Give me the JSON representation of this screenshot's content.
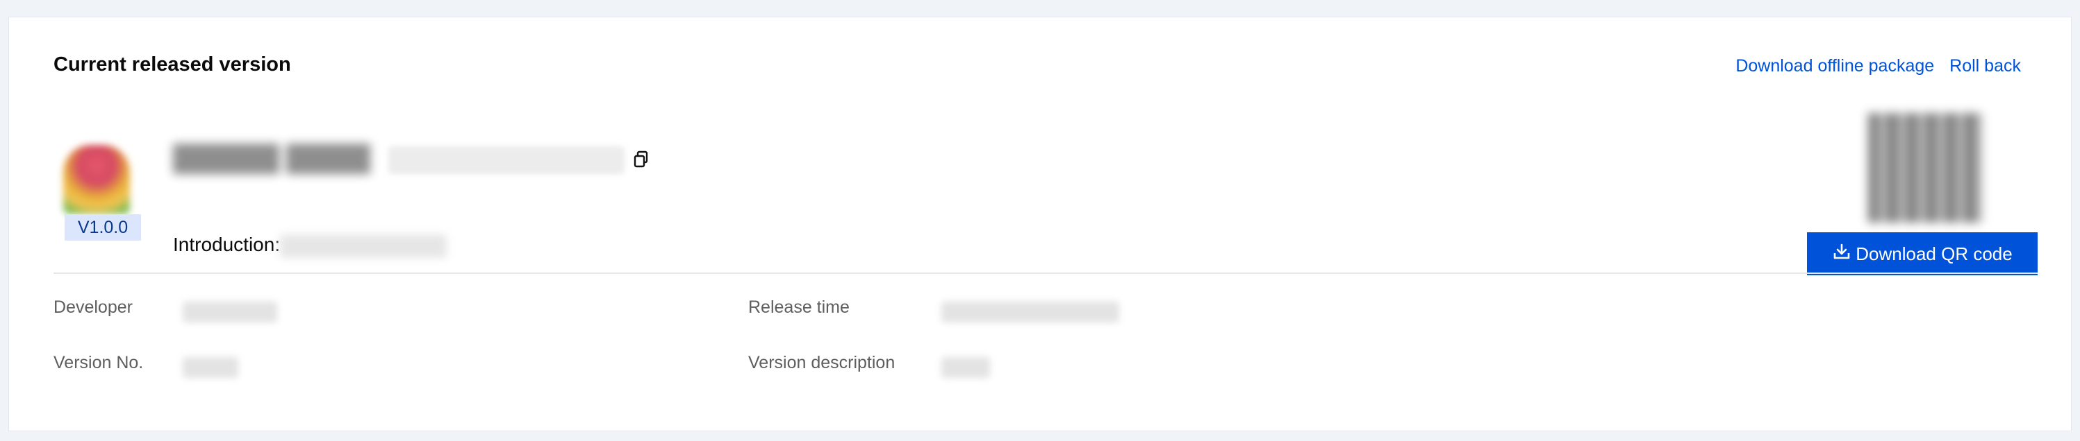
{
  "header": {
    "title": "Current released version",
    "download_offline_label": "Download offline package",
    "rollback_label": "Roll back"
  },
  "app": {
    "version_badge": "V1.0.0",
    "introduction_label": "Introduction:"
  },
  "qr": {
    "download_label": "Download QR code"
  },
  "details": {
    "developer_label": "Developer",
    "release_time_label": "Release time",
    "version_no_label": "Version No.",
    "version_description_label": "Version description"
  },
  "colors": {
    "accent": "#0052d9",
    "badge_bg": "#dbe6fc"
  },
  "icons": {
    "copy": "copy-icon",
    "download": "download-icon"
  }
}
